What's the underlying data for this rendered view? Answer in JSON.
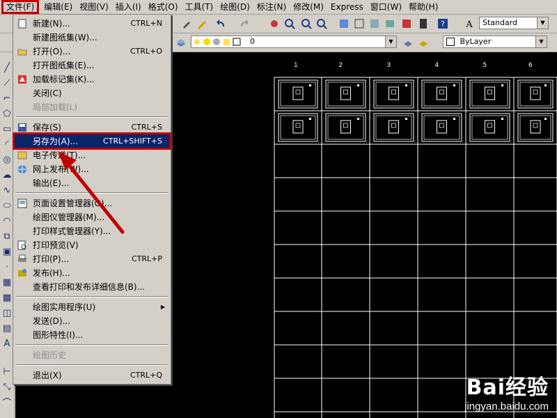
{
  "menubar": {
    "items": [
      "文件(F)",
      "编辑(E)",
      "视图(V)",
      "插入(I)",
      "格式(O)",
      "工具(T)",
      "绘图(D)",
      "标注(N)",
      "修改(M)",
      "Express",
      "窗口(W)",
      "帮助(H)"
    ]
  },
  "toolbar": {
    "text_style": "Standard",
    "layer_name": "0",
    "color": "ByLayer"
  },
  "file_menu": {
    "items": [
      {
        "label": "新建(N)...",
        "shortcut": "CTRL+N",
        "icon": "new-file-icon"
      },
      {
        "label": "新建图纸集(W)...",
        "shortcut": ""
      },
      {
        "label": "打开(O)...",
        "shortcut": "CTRL+O",
        "icon": "open-folder-icon"
      },
      {
        "label": "打开图纸集(E)...",
        "shortcut": ""
      },
      {
        "label": "加载标记集(K)...",
        "shortcut": "",
        "icon": "markup-icon"
      },
      {
        "label": "关闭(C)",
        "shortcut": ""
      },
      {
        "label": "局部加载(L)",
        "shortcut": "",
        "disabled": true
      },
      {
        "label": "保存(S)",
        "shortcut": "CTRL+S",
        "icon": "save-icon"
      },
      {
        "label": "另存为(A)...",
        "shortcut": "CTRL+SHIFT+S",
        "highlighted": true
      },
      {
        "label": "电子传递(T)...",
        "shortcut": "",
        "icon": "etransmit-icon"
      },
      {
        "label": "网上发布(W)...",
        "shortcut": "",
        "icon": "publish-web-icon"
      },
      {
        "label": "输出(E)...",
        "shortcut": ""
      },
      {
        "label": "页面设置管理器(G)...",
        "shortcut": "",
        "icon": "page-setup-icon"
      },
      {
        "label": "绘图仪管理器(M)...",
        "shortcut": ""
      },
      {
        "label": "打印样式管理器(Y)...",
        "shortcut": ""
      },
      {
        "label": "打印预览(V)",
        "shortcut": "",
        "icon": "print-preview-icon"
      },
      {
        "label": "打印(P)...",
        "shortcut": "CTRL+P",
        "icon": "print-icon"
      },
      {
        "label": "发布(H)...",
        "shortcut": "",
        "icon": "publish-icon"
      },
      {
        "label": "查看打印和发布详细信息(B)...",
        "shortcut": ""
      },
      {
        "label": "绘图实用程序(U)",
        "shortcut": "",
        "submenu": true
      },
      {
        "label": "发送(D)...",
        "shortcut": ""
      },
      {
        "label": "图形特性(I)...",
        "shortcut": ""
      },
      {
        "label": "绘图历史",
        "shortcut": "",
        "disabled": true
      },
      {
        "label": "退出(X)",
        "shortcut": "CTRL+Q"
      }
    ]
  },
  "canvas": {
    "column_labels": [
      "1",
      "2",
      "3",
      "4",
      "5",
      "6"
    ]
  },
  "watermark": {
    "logo": "Bai经验",
    "url": "jingyan.baidu.com"
  },
  "colors": {
    "canvas_bg": "#000000",
    "highlight_bg": "#0a246a",
    "annotation_red": "#c00000"
  }
}
